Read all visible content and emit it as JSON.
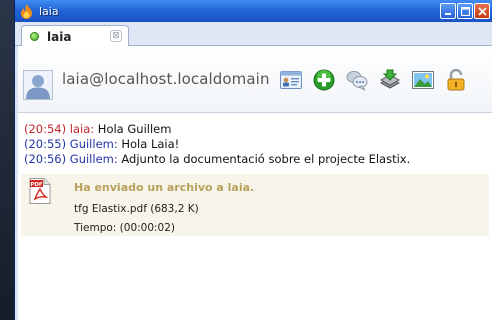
{
  "window": {
    "title": "laia",
    "minimize_glyph": "_",
    "maximize_glyph": "□",
    "close_glyph": "X"
  },
  "tab": {
    "label": "laia",
    "close_glyph": "⊠"
  },
  "header": {
    "account": "laia@localhost.localdomain",
    "toolbar_icons": [
      "contact-card-icon",
      "add-icon",
      "chat-bubbles-icon",
      "file-send-icon",
      "image-icon",
      "lock-icon"
    ]
  },
  "messages": [
    {
      "time": "(20:54)",
      "nick": "laia:",
      "text": "Hola Guillem",
      "kind": "mine"
    },
    {
      "time": "(20:55)",
      "nick": "Guillem:",
      "text": "Hola Laia!",
      "kind": "theirs"
    },
    {
      "time": "(20:56)",
      "nick": "Guillem:",
      "text": "Adjunto la documentació sobre el projecte Elastix.",
      "kind": "theirs"
    }
  ],
  "transfer": {
    "title": "Ha enviado un archivo a laia.",
    "file": "tfg Elastix.pdf (683,2 K)",
    "time": "Tiempo: (00:00:02)",
    "icon_text": "PDF"
  },
  "colors": {
    "titlebar": "#2366d8",
    "mine": "#c3262b",
    "theirs": "#2233a8",
    "transfer_title": "#b8a15c",
    "transfer_bg": "#f7f4e9"
  }
}
